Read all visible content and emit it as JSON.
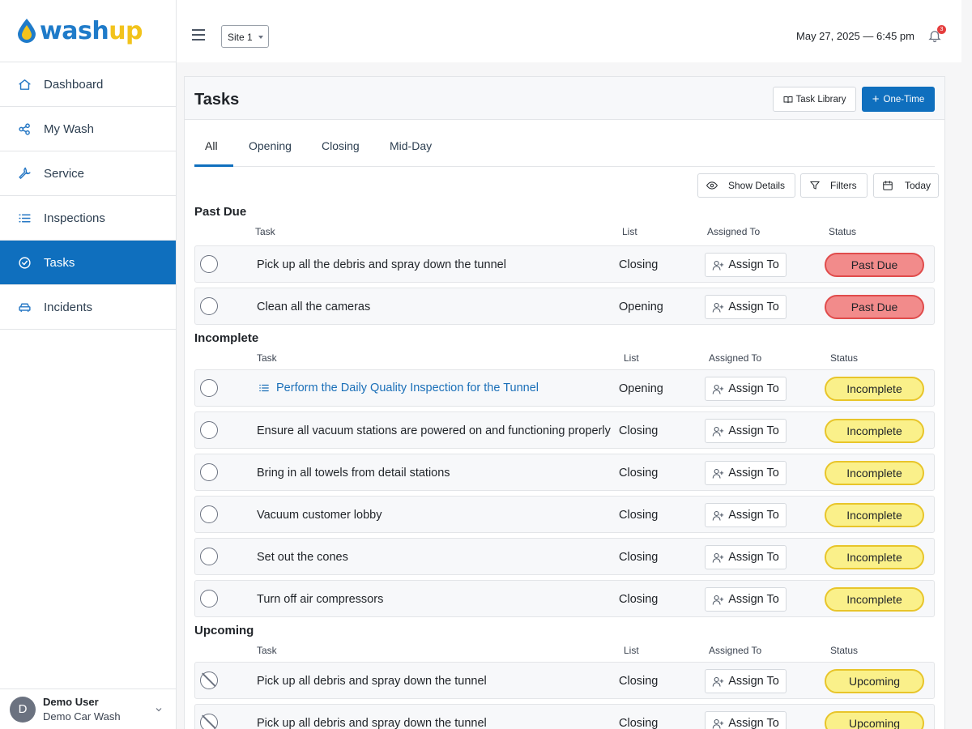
{
  "brand": {
    "logo_part1": "wash",
    "logo_part2": "up",
    "primary": "#0f6fbe",
    "accent": "#f2c31b"
  },
  "sidebar": {
    "items": [
      {
        "label": "Dashboard",
        "icon": "home-icon"
      },
      {
        "label": "My Wash",
        "icon": "share-icon"
      },
      {
        "label": "Service",
        "icon": "wrench-icon"
      },
      {
        "label": "Inspections",
        "icon": "list-icon"
      },
      {
        "label": "Tasks",
        "icon": "check-circle-icon",
        "active": true
      },
      {
        "label": "Incidents",
        "icon": "car-icon"
      }
    ],
    "user": {
      "initial": "D",
      "name": "Demo User",
      "org": "Demo Car Wash"
    }
  },
  "header": {
    "site": "Site 1",
    "datetime": "May 27, 2025 — 6:45 pm",
    "notification_count": "3"
  },
  "page": {
    "title": "Tasks",
    "task_library_label": "Task Library",
    "one_time_label": "One-Time",
    "tabs": [
      "All",
      "Opening",
      "Closing",
      "Mid-Day"
    ],
    "active_tab": "All",
    "toolbar": {
      "show_details": "Show Details",
      "filters": "Filters",
      "today": "Today"
    },
    "columns": {
      "task": "Task",
      "list": "List",
      "assigned": "Assigned To",
      "status": "Status"
    },
    "assign_label": "Assign To"
  },
  "sections": [
    {
      "title": "Past Due",
      "rows": [
        {
          "task": "Pick up all the debris and spray down the tunnel",
          "list": "Closing",
          "status": "Past Due"
        },
        {
          "task": "Clean all the cameras",
          "list": "Opening",
          "status": "Past Due"
        }
      ]
    },
    {
      "title": "Incomplete",
      "rows": [
        {
          "task": "Perform the Daily Quality Inspection for the Tunnel",
          "list": "Opening",
          "status": "Incomplete",
          "link": true
        },
        {
          "task": "Ensure all vacuum stations are powered on and functioning properly",
          "list": "Closing",
          "status": "Incomplete"
        },
        {
          "task": "Bring in all towels from detail stations",
          "list": "Closing",
          "status": "Incomplete"
        },
        {
          "task": "Vacuum customer lobby",
          "list": "Closing",
          "status": "Incomplete"
        },
        {
          "task": "Set out the cones",
          "list": "Closing",
          "status": "Incomplete"
        },
        {
          "task": "Turn off air compressors",
          "list": "Closing",
          "status": "Incomplete"
        }
      ]
    },
    {
      "title": "Upcoming",
      "rows": [
        {
          "task": "Pick up all debris and spray down the tunnel",
          "list": "Closing",
          "status": "Upcoming"
        },
        {
          "task": "Pick up all debris and spray down the tunnel",
          "list": "Closing",
          "status": "Upcoming"
        }
      ]
    }
  ],
  "status_colors": {
    "Past Due": "#f28b8b",
    "Incomplete": "#faf08a",
    "Upcoming": "#faf08a"
  }
}
